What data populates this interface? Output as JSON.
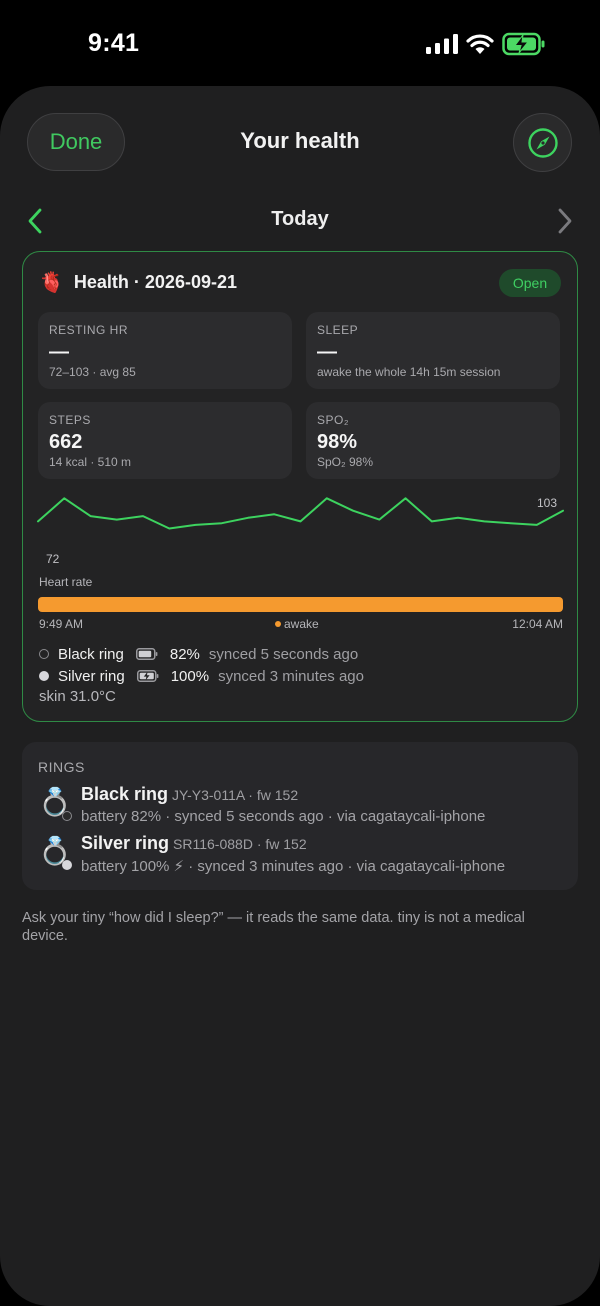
{
  "status_bar": {
    "time": "9:41"
  },
  "header": {
    "done_label": "Done",
    "title": "Your health"
  },
  "day_nav": {
    "label": "Today"
  },
  "health_card": {
    "emoji": "🫀",
    "title": "Health · 2026-09-21",
    "badge": "Open",
    "tiles": [
      {
        "label": "RESTING HR",
        "value": "—",
        "sub": "72–103 · avg 85"
      },
      {
        "label": "SLEEP",
        "value": "—",
        "sub": "awake the whole 14h 15m session"
      },
      {
        "label": "STEPS",
        "value": "662",
        "sub": "14 kcal · 510 m"
      },
      {
        "label": "SPO₂",
        "value": "98%",
        "sub": "SpO₂ 98%"
      }
    ],
    "chart_caption": "Heart rate",
    "sleep_bar": {
      "start": "9:49 AM",
      "stage": "awake",
      "end": "12:04 AM"
    },
    "rings": [
      {
        "name": "Black ring",
        "battery": "82%",
        "sync": "synced 5 seconds ago",
        "charging": false
      },
      {
        "name": "Silver ring",
        "battery": "100%",
        "sync": "synced 3 minutes ago",
        "charging": true
      }
    ],
    "skin": "skin 31.0°C"
  },
  "chart_data": {
    "type": "line",
    "title": "",
    "xlabel": "Heart rate",
    "ylabel": "",
    "min_label": "72",
    "max_label": "103",
    "ylim": [
      72,
      103
    ],
    "series": [
      {
        "values": [
          87,
          100,
          90,
          88,
          90,
          83,
          85,
          86,
          89,
          91,
          87,
          100,
          93,
          88,
          100,
          87,
          89,
          87,
          86,
          85,
          93
        ]
      }
    ],
    "color": "#3dd35f"
  },
  "rings_section": {
    "title": "RINGS",
    "items": [
      {
        "emoji": "💍",
        "name": "Black ring",
        "serial": "JY-Y3-011A · fw 152",
        "detail": "battery 82% · synced 5 seconds ago · via cagataycali-iphone"
      },
      {
        "emoji": "💍",
        "name": "Silver ring",
        "serial": "SR116-088D · fw 152",
        "detail": "battery 100% ⚡ · synced 3 minutes ago · via cagataycali-iphone"
      }
    ]
  },
  "footnote": "Ask your tiny “how did I sleep?” — it reads the same data. tiny is not a medical device.",
  "colors": {
    "accent": "#3dd35f",
    "sleep_awake": "#f59a2f",
    "card_border": "#2f8a45"
  },
  "icons": {
    "cellular": "cellular-signal-icon",
    "wifi": "wifi-icon",
    "battery": "battery-charging-icon",
    "compass": "compass-icon"
  }
}
